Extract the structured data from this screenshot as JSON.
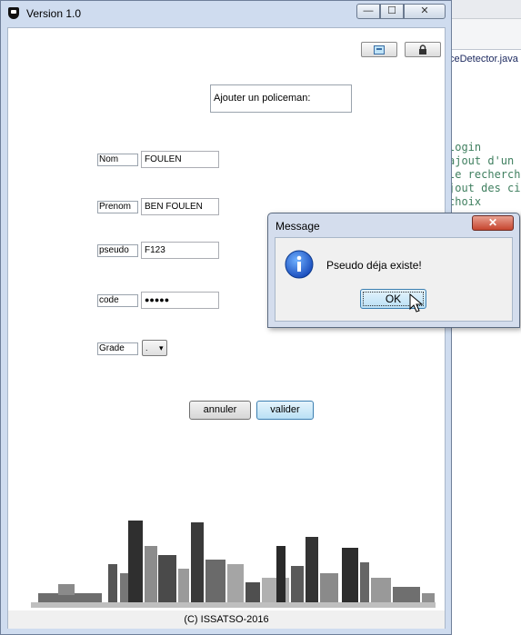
{
  "window": {
    "title": "Version 1.0",
    "minimize_label": "—",
    "maximize_label": "☐",
    "close_label": "✕"
  },
  "toolbar": {
    "button1_icon": "info-card-icon",
    "button2_icon": "lock-icon"
  },
  "form": {
    "title": "Ajouter un policeman:",
    "fields": [
      {
        "label": "Nom",
        "value": "FOULEN"
      },
      {
        "label": "Prenom",
        "value": "BEN FOULEN"
      },
      {
        "label": "pseudo",
        "value": "F123"
      },
      {
        "label": "code",
        "value": "●●●●●"
      }
    ],
    "grade": {
      "label": "Grade",
      "selected": ".",
      "arrow": "▾"
    },
    "cancel_label": "annuler",
    "submit_label": "valider"
  },
  "footer": {
    "copyright": "(C) ISSATSO-2016"
  },
  "dialog": {
    "title": "Message",
    "message": "Pseudo déja existe!",
    "ok_label": "OK",
    "close_label": "✕",
    "icon": "info-icon"
  },
  "ide": {
    "tab_label": "ceDetector.java",
    "code_lines": [
      "login",
      "ajout d'un",
      "le recherche",
      "jout des ci",
      "choix"
    ]
  },
  "colors": {
    "accent": "#3c7fb1",
    "close_red": "#c6452e",
    "window_frame": "#cfdcef"
  }
}
